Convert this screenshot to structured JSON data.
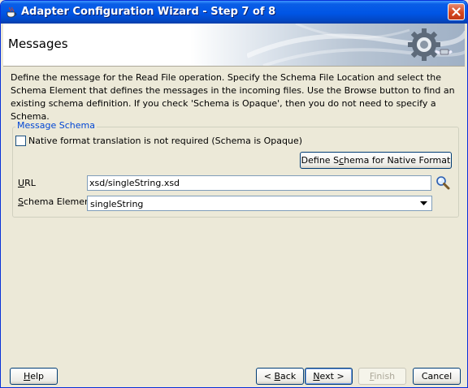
{
  "window": {
    "title": "Adapter Configuration Wizard - Step 7 of 8"
  },
  "header": {
    "title": "Messages"
  },
  "description": "Define the message for the Read File operation.  Specify the Schema File Location and select the Schema Element that defines the messages in the incoming files. Use the Browse button to find an existing schema definition. If you check 'Schema is Opaque', then you do not need to specify a Schema.",
  "message_schema": {
    "legend": "Message Schema",
    "opaque_checkbox": {
      "label": "Native format translation is not required (Schema is Opaque)",
      "checked": false
    },
    "define_button": {
      "label_pre": "Define S",
      "label_u": "c",
      "label_post": "hema for Native Format"
    },
    "url": {
      "label_u": "U",
      "label_post": "RL",
      "value": "xsd/singleString.xsd"
    },
    "schema_element": {
      "label_u": "S",
      "label_post": "chema Element",
      "value": "singleString"
    }
  },
  "footer": {
    "help": {
      "label_u": "H",
      "label_post": "elp"
    },
    "back": {
      "label_pre": "< ",
      "label_u": "B",
      "label_post": "ack"
    },
    "next": {
      "label_u": "N",
      "label_post": "ext >"
    },
    "finish": {
      "label_u": "F",
      "label_post": "inish"
    },
    "cancel": {
      "label": "Cancel"
    }
  },
  "icons": {
    "title": "java-cup-icon",
    "close": "close-icon",
    "banner": "gear-plug-icon",
    "search": "search-icon",
    "dropdown": "chevron-down-icon"
  },
  "colors": {
    "titlebar": "#0055e5",
    "close_button": "#d5451c",
    "legend_text": "#0046d5",
    "dialog_bg": "#ece9d8"
  }
}
